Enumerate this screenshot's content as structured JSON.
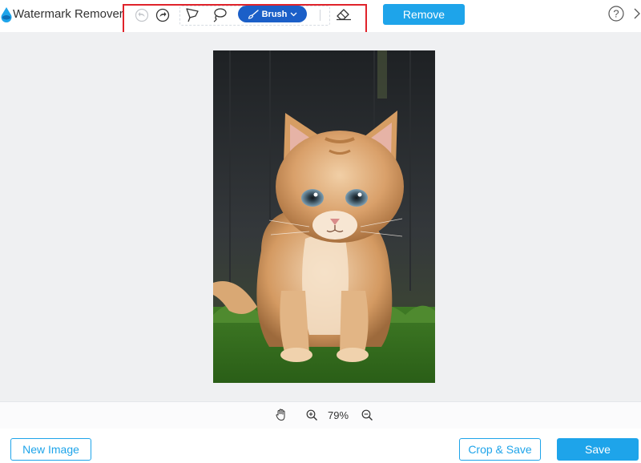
{
  "app": {
    "title": "Watermark Remover"
  },
  "toolbar": {
    "undo_icon": "undo-icon",
    "redo_icon": "redo-icon",
    "polygon_icon": "polygonal-lasso-icon",
    "lasso_icon": "lasso-icon",
    "brush_label": "Brush",
    "eraser_icon": "eraser-icon",
    "remove_label": "Remove"
  },
  "header": {
    "help_icon": "help-icon",
    "close_icon": "close-icon"
  },
  "zoom": {
    "level": "79%",
    "pan_icon": "hand-icon",
    "zoom_in_icon": "zoom-in-icon",
    "zoom_out_icon": "zoom-out-icon"
  },
  "footer": {
    "new_image_label": "New Image",
    "crop_save_label": "Crop & Save",
    "save_label": "Save"
  },
  "colors": {
    "accent": "#1ea4ea",
    "brush_active": "#1b5fc8",
    "highlight": "#e0232b",
    "canvas_bg": "#eff0f2"
  }
}
